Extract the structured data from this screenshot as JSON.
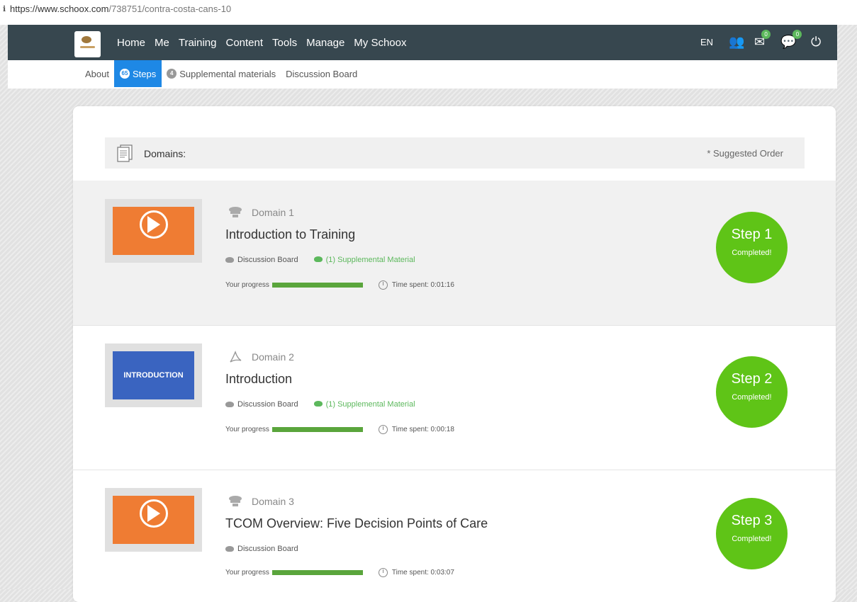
{
  "browser": {
    "url_host": "https://www.schoox.com",
    "url_path": "/738751/contra-costa-cans-10"
  },
  "nav": {
    "menu": [
      "Home",
      "Me",
      "Training",
      "Content",
      "Tools",
      "Manage",
      "My Schoox"
    ],
    "lang": "EN",
    "mail_badge": "0",
    "chat_badge": "0"
  },
  "tabs": {
    "about": "About",
    "steps_count": "65",
    "steps": "Steps",
    "supp_count": "4",
    "supplemental": "Supplemental materials",
    "discussion": "Discussion Board"
  },
  "domains": {
    "label": "Domains:",
    "order": "* Suggested Order",
    "items": [
      {
        "domain": "Domain 1",
        "icon": "video-domain-icon",
        "thumb": "video",
        "title": "Introduction to Training",
        "discussion": "Discussion Board",
        "supplemental": "(1) Supplemental Material",
        "progress_label": "Your progress",
        "progress": 1.0,
        "time": "Time spent: 0:01:16",
        "step": "Step 1",
        "status": "Completed!"
      },
      {
        "domain": "Domain 2",
        "icon": "pdf-icon",
        "thumb": "intro",
        "thumb_text": "INTRODUCTION",
        "title": "Introduction",
        "discussion": "Discussion Board",
        "supplemental": "(1) Supplemental Material",
        "progress_label": "Your progress",
        "progress": 1.0,
        "time": "Time spent: 0:00:18",
        "step": "Step 2",
        "status": "Completed!"
      },
      {
        "domain": "Domain 3",
        "icon": "video-domain-icon",
        "thumb": "video",
        "title": "TCOM Overview: Five Decision Points of Care",
        "discussion": "Discussion Board",
        "progress_label": "Your progress",
        "progress": 1.0,
        "time": "Time spent: 0:03:07",
        "step": "Step 3",
        "status": "Completed!"
      }
    ]
  },
  "colors": {
    "nav": "#37474f",
    "active_tab": "#1e88e5",
    "step_green": "#5fc417",
    "video_orange": "#ef7c33",
    "intro_blue": "#3a64c0"
  }
}
